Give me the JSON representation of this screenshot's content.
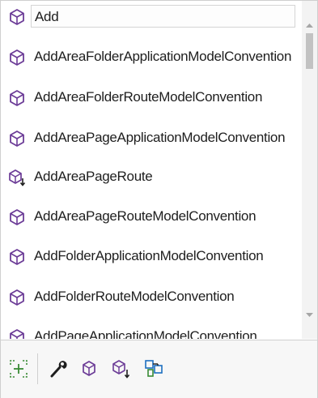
{
  "completion_list": {
    "items": [
      {
        "label": "Add",
        "icon": "method-icon",
        "selected": true
      },
      {
        "label": "AddAreaFolderApplicationModelConvention",
        "icon": "method-icon"
      },
      {
        "label": "AddAreaFolderRouteModelConvention",
        "icon": "method-icon"
      },
      {
        "label": "AddAreaPageApplicationModelConvention",
        "icon": "method-icon"
      },
      {
        "label": "AddAreaPageRoute",
        "icon": "extension-method-icon"
      },
      {
        "label": "AddAreaPageRouteModelConvention",
        "icon": "method-icon"
      },
      {
        "label": "AddFolderApplicationModelConvention",
        "icon": "method-icon"
      },
      {
        "label": "AddFolderRouteModelConvention",
        "icon": "method-icon"
      },
      {
        "label": "AddPageApplicationModelConvention",
        "icon": "method-icon"
      }
    ]
  },
  "toolbar": {
    "buttons": [
      {
        "name": "target-typed-completion-icon"
      },
      {
        "name": "wrench-icon"
      },
      {
        "name": "method-filter-icon"
      },
      {
        "name": "extension-method-filter-icon"
      },
      {
        "name": "class-filter-icon"
      }
    ]
  },
  "colors": {
    "icon_purple": "#6c3c97",
    "icon_blue": "#1d6fc0",
    "border": "#cfcfcf",
    "toolbar_green": "#388a34"
  }
}
